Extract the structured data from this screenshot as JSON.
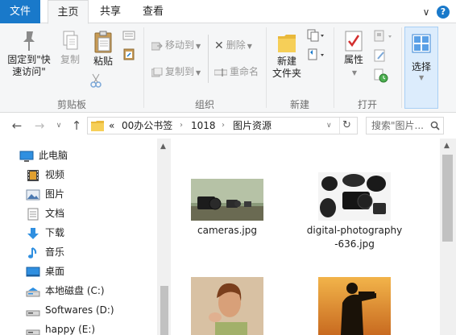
{
  "tabs": {
    "file": "文件",
    "home": "主页",
    "share": "共享",
    "view": "查看"
  },
  "window_controls": {
    "collapse": "∨",
    "help": "?"
  },
  "ribbon": {
    "clipboard": {
      "pin_line1": "固定到\"快",
      "pin_line2": "速访问\"",
      "copy": "复制",
      "paste": "粘贴",
      "group": "剪贴板"
    },
    "organize": {
      "move_to": "移动到",
      "copy_to": "复制到",
      "delete": "删除",
      "rename": "重命名",
      "group": "组织"
    },
    "new": {
      "folder_line1": "新建",
      "folder_line2": "文件夹",
      "group": "新建"
    },
    "open": {
      "properties": "属性",
      "group": "打开"
    },
    "select": {
      "label": "选择"
    }
  },
  "address": {
    "overflow": "«",
    "segments": [
      "00办公书签",
      "1018",
      "图片资源"
    ],
    "search_placeholder": "搜索\"图片..."
  },
  "nav": {
    "items": [
      {
        "label": "此电脑",
        "icon": "computer-icon"
      },
      {
        "label": "视频",
        "icon": "video-icon"
      },
      {
        "label": "图片",
        "icon": "pictures-icon"
      },
      {
        "label": "文档",
        "icon": "document-icon"
      },
      {
        "label": "下载",
        "icon": "download-icon"
      },
      {
        "label": "音乐",
        "icon": "music-icon"
      },
      {
        "label": "桌面",
        "icon": "desktop-icon"
      },
      {
        "label": "本地磁盘 (C:)",
        "icon": "drive-icon"
      },
      {
        "label": "Softwares (D:)",
        "icon": "drive-icon"
      },
      {
        "label": "happy (E:)",
        "icon": "drive-icon"
      }
    ]
  },
  "files": [
    {
      "name": "cameras.jpg",
      "thumb": "cameras-thumbnail"
    },
    {
      "name": "digital-photography-636.jpg",
      "thumb": "digital-photography-thumbnail"
    },
    {
      "name": "",
      "thumb": "portrait-thumbnail"
    },
    {
      "name": "",
      "thumb": "photographer-silhouette-thumbnail"
    }
  ],
  "colors": {
    "file_tab": "#1979ca",
    "accent_blue": "#1979ca",
    "selected": "#dcecfc"
  }
}
